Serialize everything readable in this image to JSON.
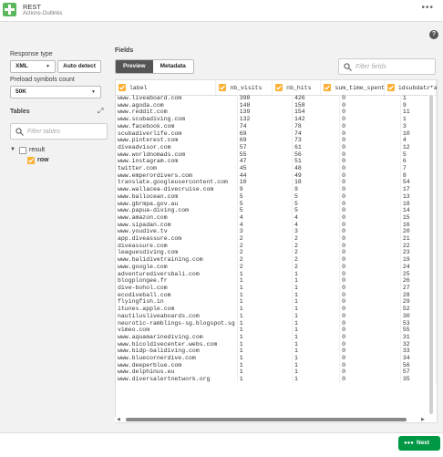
{
  "app": {
    "title": "REST",
    "subtitle": "Actions-Outlinks"
  },
  "left": {
    "response_type_label": "Response type",
    "response_type_value": "XML",
    "auto_detect_label": "Auto detect",
    "preload_label": "Preload symbols count",
    "preload_value": "50K",
    "tables_label": "Tables",
    "filter_tables_placeholder": "Filter tables",
    "tree": [
      {
        "label": "result",
        "checked": false
      },
      {
        "label": "row",
        "checked": true
      }
    ]
  },
  "fields": {
    "label": "Fields",
    "tabs": [
      "Preview",
      "Metadata"
    ],
    "filter_placeholder": "Filter fields",
    "columns": [
      "label",
      "nb_visits",
      "nb_hits",
      "sum_time_spent",
      "idsubdatatab"
    ],
    "rows": [
      [
        "www.liveaboard.com",
        "398",
        "426",
        "0",
        "1"
      ],
      [
        "www.agoda.com",
        "148",
        "158",
        "0",
        "9"
      ],
      [
        "www.reddit.com",
        "139",
        "154",
        "0",
        "11"
      ],
      [
        "www.scubadiving.com",
        "132",
        "142",
        "0",
        "1"
      ],
      [
        "www.facebook.com",
        "74",
        "78",
        "0",
        "3"
      ],
      [
        "scubadiverlife.com",
        "69",
        "74",
        "0",
        "10"
      ],
      [
        "www.pinterest.com",
        "69",
        "73",
        "0",
        "4"
      ],
      [
        "diveadvisor.com",
        "57",
        "61",
        "0",
        "12"
      ],
      [
        "www.worldnomads.com",
        "55",
        "56",
        "0",
        "5"
      ],
      [
        "www.instagram.com",
        "47",
        "51",
        "0",
        "6"
      ],
      [
        "twitter.com",
        "45",
        "48",
        "0",
        "7"
      ],
      [
        "www.emperordivers.com",
        "44",
        "49",
        "0",
        "8"
      ],
      [
        "translate.googleusercontent.com",
        "10",
        "18",
        "0",
        "54"
      ],
      [
        "www.wallacea-divecruise.com",
        "9",
        "9",
        "0",
        "17"
      ],
      [
        "www.ballocean.com",
        "5",
        "5",
        "0",
        "13"
      ],
      [
        "www.gbrmpa.gov.au",
        "5",
        "5",
        "0",
        "18"
      ],
      [
        "www.papua-diving.com",
        "5",
        "5",
        "0",
        "14"
      ],
      [
        "www.amazon.com",
        "4",
        "4",
        "0",
        "15"
      ],
      [
        "www.sipadan.com",
        "4",
        "4",
        "0",
        "16"
      ],
      [
        "www.youdive.tv",
        "3",
        "3",
        "0",
        "20"
      ],
      [
        "app.diveassure.com",
        "2",
        "2",
        "0",
        "21"
      ],
      [
        "diveassure.com",
        "2",
        "2",
        "0",
        "22"
      ],
      [
        "leaguesdiving.com",
        "2",
        "2",
        "0",
        "23"
      ],
      [
        "www.balidivetraining.com",
        "2",
        "2",
        "0",
        "19"
      ],
      [
        "www.google.com",
        "2",
        "2",
        "0",
        "24"
      ],
      [
        "adventurediversbali.com",
        "1",
        "1",
        "0",
        "25"
      ],
      [
        "blogplongee.fr",
        "1",
        "1",
        "0",
        "26"
      ],
      [
        "dive-bohol.com",
        "1",
        "1",
        "0",
        "27"
      ],
      [
        "ecodiveball.com",
        "1",
        "1",
        "0",
        "28"
      ],
      [
        "flyingfish.in",
        "1",
        "1",
        "0",
        "29"
      ],
      [
        "itunes.apple.com",
        "1",
        "1",
        "0",
        "52"
      ],
      [
        "nautilusliveaboards.com",
        "1",
        "1",
        "0",
        "30"
      ],
      [
        "neurotic-ramblings-sg.blogspot.sg",
        "1",
        "1",
        "0",
        "53"
      ],
      [
        "vimeo.com",
        "1",
        "1",
        "0",
        "55"
      ],
      [
        "www.aquamarinediving.com",
        "1",
        "1",
        "0",
        "31"
      ],
      [
        "www.bicoldivecenter.webs.com",
        "1",
        "1",
        "0",
        "32"
      ],
      [
        "www.bidp-balidiving.com",
        "1",
        "1",
        "0",
        "33"
      ],
      [
        "www.bluecornerdive.com",
        "1",
        "1",
        "0",
        "34"
      ],
      [
        "www.deeperblue.com",
        "1",
        "1",
        "0",
        "56"
      ],
      [
        "www.delphinus.eu",
        "1",
        "1",
        "0",
        "57"
      ],
      [
        "www.diversalertnetwork.org",
        "1",
        "1",
        "0",
        "35"
      ]
    ]
  },
  "footer": {
    "next_label": "Next"
  },
  "colors": {
    "accent": "#009845",
    "checkbox": "#fbb034"
  }
}
